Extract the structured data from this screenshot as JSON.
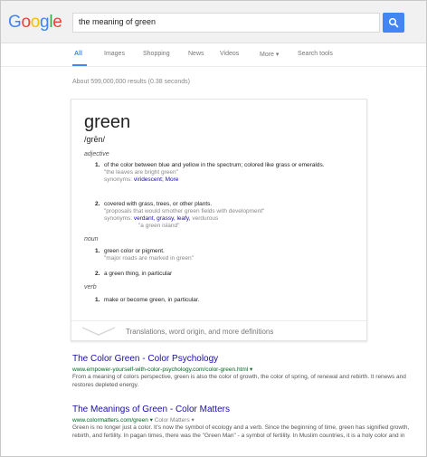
{
  "search": {
    "logo": "Google",
    "query": "the meaning of green"
  },
  "tabs": [
    "All",
    "Images",
    "Shopping",
    "News",
    "Videos",
    "More ▾",
    "Search tools"
  ],
  "results_count": "About 599,000,000 results (0.38 seconds)",
  "definition": {
    "word": "green",
    "phonetic": "/grēn/",
    "sections": [
      {
        "pos": "adjective",
        "senses": [
          {
            "num": "1.",
            "text": "of the color between blue and yellow in the spectrum; colored like grass or emeralds.",
            "example": "\"the leaves are bright green\"",
            "synonyms_label": "synonyms:",
            "synonyms": "viridescent;",
            "more": "More"
          },
          {
            "num": "2.",
            "text": "covered with grass, trees, or other plants.",
            "example": "\"proposals that would smother green fields with development\"",
            "synonyms_label": "synonyms:",
            "synonyms": "verdant, grassy, leafy,",
            "synonyms_plain": "verdurous",
            "example2": "\"a green island\""
          }
        ]
      },
      {
        "pos": "noun",
        "senses": [
          {
            "num": "1.",
            "text": "green color or pigment.",
            "example": "\"major roads are marked in green\""
          },
          {
            "num": "2.",
            "text": "a green thing, in particular"
          }
        ]
      },
      {
        "pos": "verb",
        "senses": [
          {
            "num": "1.",
            "text": "make or become green, in particular."
          }
        ]
      }
    ],
    "footer": "Translations, word origin, and more definitions"
  },
  "results": [
    {
      "title": "The Color Green - Color Psychology",
      "url": "www.empower-yourself-with-color-psychology.com/color-green.html",
      "snippet": "From a meaning of colors perspective, green is also the color of growth, the color of spring, of renewal and rebirth. It renews and restores depleted energy."
    },
    {
      "title": "The Meanings of Green - Color Matters",
      "url": "www.colormatters.com/green",
      "crumb": "Color Matters",
      "snippet": "Green is no longer just a color. It's now the symbol of ecology and a verb. Since the beginning of time, green has signified growth, rebirth, and fertility. In pagan times, there was the \"Green Man\" - a symbol of fertility. In Muslim countries, it is a holy color and in"
    }
  ],
  "colors": {
    "link": "#1a0dab",
    "url": "#006621",
    "accent": "#4285f4"
  }
}
